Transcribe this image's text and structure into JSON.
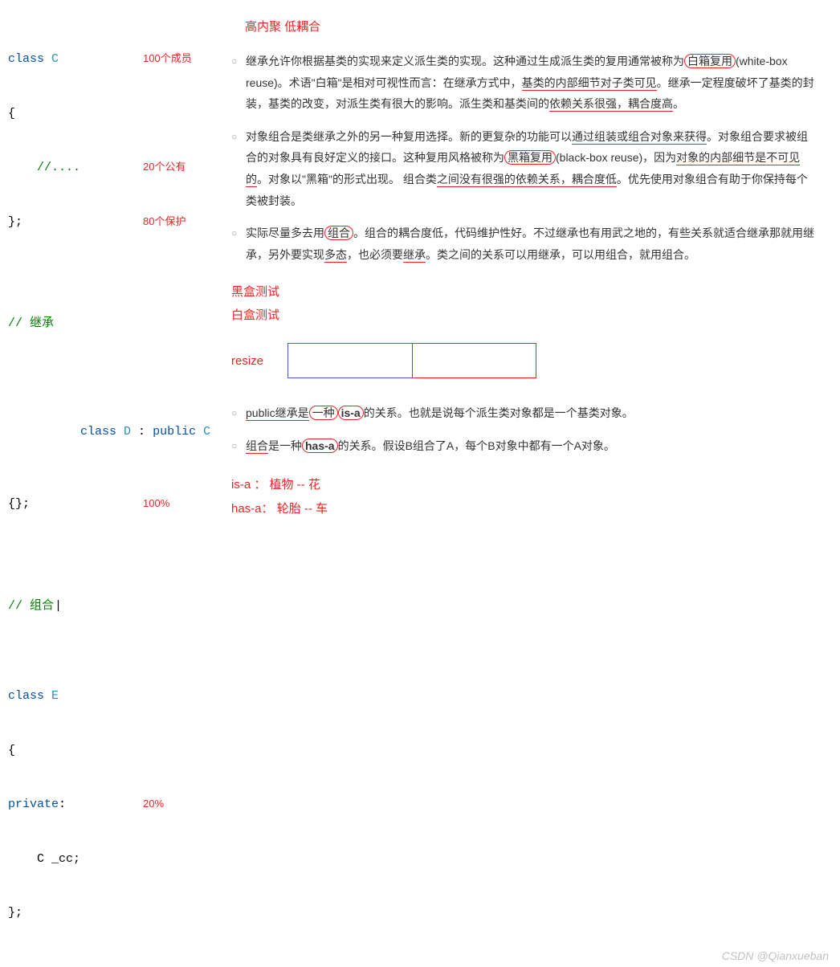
{
  "left": {
    "code_c": {
      "l1_kw": "class",
      "l1_cls": " C",
      "l1_anno": "100个成员",
      "l2": "{",
      "l3": "    //....",
      "l3_anno": "20个公有",
      "l4": "};",
      "l4_anno": "80个保护"
    },
    "inherit_comment": "// 继承",
    "code_d": {
      "l1_kw": "class",
      "l1_cls": " D ",
      "l1_colon": ": ",
      "l1_mod": "public",
      "l1_base": " C",
      "l2": "{};",
      "l2_anno": "100%"
    },
    "compose_comment": "// 组合",
    "code_e": {
      "l1_kw": "class",
      "l1_cls": " E",
      "l2": "{",
      "l3_acc": "private",
      "l3_colon": ":",
      "l3_anno": "20%",
      "l4": "    C _cc;",
      "l5": "};"
    }
  },
  "right": {
    "heading": "高内聚  低耦合",
    "bullets1": {
      "b1_a": "继承允许你根据基类的实现来定义派生类的实现。这种通过生成派生类的复用通常被称为",
      "b1_wb": "白箱复用",
      "b1_b": "(white-box reuse)。术语\"白箱\"是相对可视性而言：在继承方式中，",
      "b1_vis": "基类的内部细节对子类可见",
      "b1_c": "。继承一定程度破坏了基类的封装，基类的改变，对派生类有很大的影响。派生类和基类间的",
      "b1_dep": "依赖关系很强，耦合度高",
      "b1_d": "。",
      "b2_a": "对象组合是类继承之外的另一种复用选择。新的更复杂的功能可以",
      "b2_assm": "通过组装或组合对象来获得",
      "b2_b": "。对象组合要求被组合的对象具有良好定义的接口。这种复用风格被称为",
      "b2_bb": "黑箱复用",
      "b2_c": "(black-box reuse)，因为",
      "b2_inv": "对象的内部细节是不可见的",
      "b2_d": "。对象以\"黑箱\"的形式出现。 组合类",
      "b2_nodep": "之间没有很强的依赖关系，耦合度低",
      "b2_e": "。优先使用对象组合有助于你保持每个类被封装。",
      "b3_a": "实际尽量多去用",
      "b3_comp": "组合",
      "b3_b": "。组合的耦合度低，代码维护性好。不过继承也有用武之地的，有些关系就适合继承那就用继承，另外要实现",
      "b3_poly": "多态",
      "b3_c": "，也必须要",
      "b3_inh": "继承",
      "b3_d": "。类之间的关系可以用继承，可以用组合，就用组合。"
    },
    "blackbox": "黑盒测试",
    "whitebox": "白盒测试",
    "resize": "resize",
    "bullets2": {
      "b1_a": "public继承是",
      "b1_isa_pre": "一种",
      "b1_isa": "is-a",
      "b1_b": "的关系。也就是说每个派生类对象都是一个基类对象。",
      "b2_a": "组合",
      "b2_pre": "是一种",
      "b2_hasa": "has-a",
      "b2_b": "的关系。假设B组合了A，每个B对象中都有一个A对象。"
    },
    "examples": {
      "isa": "is-a  ：  植物   --  花",
      "hasa": "has-a： 轮胎   --  车"
    }
  },
  "watermark": "CSDN @Qianxueban"
}
